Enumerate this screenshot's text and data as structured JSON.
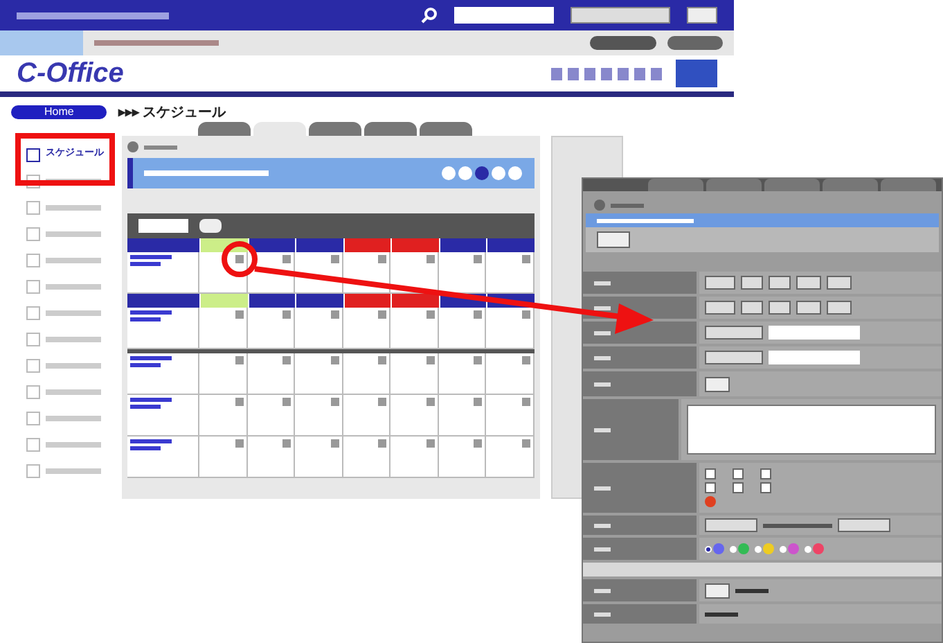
{
  "logo": "C-Office",
  "breadcrumb": {
    "home": "Home",
    "current": "▸▸▸ スケジュール"
  },
  "view_tabs": [
    {
      "selected": false
    },
    {
      "selected": true
    },
    {
      "selected": false
    },
    {
      "selected": false
    },
    {
      "selected": false
    }
  ],
  "sidebar": [
    {
      "label": "スケジュール",
      "selected": true
    },
    {
      "selected": false
    },
    {
      "selected": false
    },
    {
      "selected": false
    },
    {
      "selected": false
    },
    {
      "selected": false
    },
    {
      "selected": false
    },
    {
      "selected": false
    },
    {
      "selected": false
    },
    {
      "selected": false
    },
    {
      "selected": false
    },
    {
      "selected": false
    },
    {
      "selected": false
    }
  ],
  "calendar": {
    "days": [
      {
        "kind": "today"
      },
      {
        "kind": "weekday"
      },
      {
        "kind": "weekday"
      },
      {
        "kind": "holiday"
      },
      {
        "kind": "holiday"
      },
      {
        "kind": "weekday"
      },
      {
        "kind": "weekday"
      }
    ],
    "groups": [
      {
        "kind": "header"
      },
      {
        "kind": "header"
      },
      {
        "kind": "plain"
      }
    ]
  },
  "form": {
    "rows": [
      {
        "kind": "datetime"
      },
      {
        "kind": "datetime"
      },
      {
        "kind": "select-text"
      },
      {
        "kind": "select-text"
      },
      {
        "kind": "button"
      },
      {
        "kind": "textarea"
      },
      {
        "kind": "options"
      },
      {
        "kind": "selects"
      },
      {
        "kind": "colors"
      },
      {
        "kind": "gap"
      },
      {
        "kind": "button-name"
      },
      {
        "kind": "name"
      }
    ],
    "options": [
      {
        "checked": false
      },
      {
        "checked": false
      },
      {
        "checked": false
      },
      {
        "checked": false
      },
      {
        "checked": false
      },
      {
        "checked": false
      }
    ],
    "colors": [
      {
        "color": "#6666ee",
        "selected": true
      },
      {
        "color": "#33bb55",
        "selected": false
      },
      {
        "color": "#eecc22",
        "selected": false
      },
      {
        "color": "#cc55cc",
        "selected": false
      },
      {
        "color": "#ee4466",
        "selected": false
      }
    ]
  }
}
